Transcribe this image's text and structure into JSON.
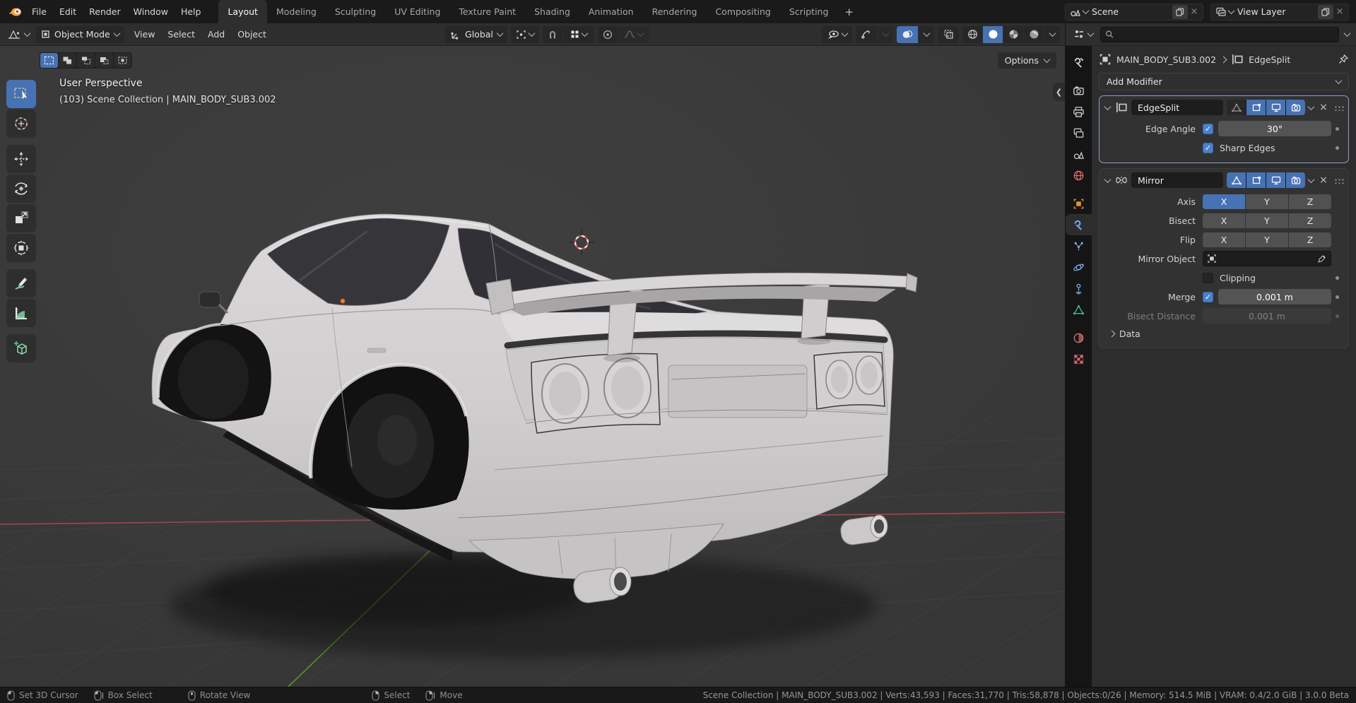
{
  "topbar": {
    "menus": [
      "File",
      "Edit",
      "Render",
      "Window",
      "Help"
    ],
    "workspaces": [
      "Layout",
      "Modeling",
      "Sculpting",
      "UV Editing",
      "Texture Paint",
      "Shading",
      "Animation",
      "Rendering",
      "Compositing",
      "Scripting"
    ],
    "add_tab": "+",
    "scene_selector": {
      "value": "Scene"
    },
    "view_layer_selector": {
      "value": "View Layer"
    }
  },
  "viewport_header": {
    "mode": "Object Mode",
    "menus": [
      "View",
      "Select",
      "Add",
      "Object"
    ],
    "orientation": "Global"
  },
  "viewport": {
    "options_button": "Options",
    "perspective_label": "User Perspective",
    "collection_label": "(103) Scene Collection | MAIN_BODY_SUB3.002"
  },
  "properties": {
    "breadcrumb": {
      "object": "MAIN_BODY_SUB3.002",
      "modifier": "EdgeSplit"
    },
    "add_modifier_button": "Add Modifier",
    "edgesplit": {
      "name": "EdgeSplit",
      "edge_angle_label": "Edge Angle",
      "edge_angle_value": "30°",
      "sharp_edges_label": "Sharp Edges",
      "checkmark": "✓"
    },
    "mirror": {
      "name": "Mirror",
      "axis_label": "Axis",
      "bisect_label": "Bisect",
      "flip_label": "Flip",
      "axis": [
        "X",
        "Y",
        "Z"
      ],
      "mirror_object_label": "Mirror Object",
      "clipping_label": "Clipping",
      "merge_label": "Merge",
      "merge_value": "0.001 m",
      "bisect_distance_label": "Bisect Distance",
      "bisect_distance_value": "0.001 m",
      "data_section_label": "Data",
      "checkmark": "✓"
    }
  },
  "statusbar": {
    "hints": [
      "Set 3D Cursor",
      "Box Select",
      "Rotate View",
      "Select",
      "Move"
    ],
    "stats": "Scene Collection | MAIN_BODY_SUB3.002 | Verts:43,593 | Faces:31,770 | Tris:58,878 | Objects:0/26 | Memory: 514.5 MiB | VRAM: 0.4/2.0 GiB | 3.0.0 Beta"
  },
  "colors": {
    "accent_blue": "#4772b3",
    "checkbox_blue": "#4b80cc",
    "axis_x_red": "#a8434e",
    "axis_y_green": "#5f8f28",
    "object_orange": "#e0912f",
    "data_green": "#45c08a",
    "world_red": "#e07070"
  }
}
